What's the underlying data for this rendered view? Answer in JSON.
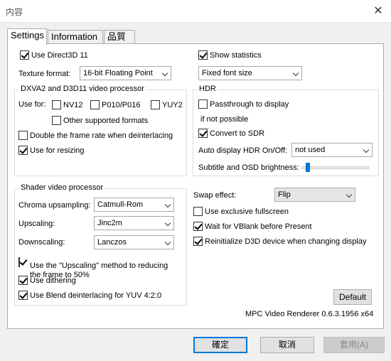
{
  "window": {
    "title": "内容",
    "close_glyph": "✕"
  },
  "tabs": [
    "Settings",
    "Information",
    "品質"
  ],
  "left": {
    "use_d3d11": {
      "label": "Use Direct3D 11",
      "checked": true
    },
    "texture_format": {
      "label": "Texture format:",
      "value": "16-bit Floating Point"
    },
    "dxva": {
      "title": "DXVA2 and D3D11 video processor",
      "use_for_label": "Use for:",
      "nv12": {
        "label": "NV12",
        "checked": false
      },
      "p010": {
        "label": "P010/P016",
        "checked": false
      },
      "yuy2": {
        "label": "YUY2",
        "checked": false
      },
      "other": {
        "label": "Other supported formats",
        "checked": false
      },
      "double_rate": {
        "label": "Double the frame rate when deinterlacing",
        "checked": false
      },
      "resizing": {
        "label": "Use for resizing",
        "checked": true
      }
    },
    "shader": {
      "title": "Shader video processor",
      "chroma_label": "Chroma upsampling:",
      "chroma_value": "Catmull-Rom",
      "upscaling_label": "Upscaling:",
      "upscaling_value": "Jinc2m",
      "downscaling_label": "Downscaling:",
      "downscaling_value": "Lanczos",
      "use_upscaling_method": {
        "label_line1": "Use the \"Upscaling\" method to reducing",
        "label_line2": "the frame to 50%",
        "checked": true
      },
      "dithering": {
        "label": "Use dithering",
        "checked": true
      },
      "blend_deinterlace": {
        "label": "Use Blend deinterlacing for YUV 4:2:0",
        "checked": true
      }
    }
  },
  "right": {
    "show_stats": {
      "label": "Show statistics",
      "checked": true
    },
    "font_size": {
      "value": "Fixed font size"
    },
    "hdr": {
      "title": "HDR",
      "passthrough": {
        "label": "Passthrough to display",
        "checked": false
      },
      "if_not_possible": "if not possible",
      "convert_sdr": {
        "label": "Convert to SDR",
        "checked": true
      },
      "auto_label": "Auto display HDR On/Off:",
      "auto_value": "not used",
      "brightness_label": "Subtitle and OSD brightness:",
      "brightness_level": 0.06
    },
    "swap_label": "Swap effect:",
    "swap_value": "Flip",
    "exclusive_fs": {
      "label": "Use exclusive fullscreen",
      "checked": false
    },
    "vblank": {
      "label": "Wait for VBlank before Present",
      "checked": true
    },
    "reinit_d3d": {
      "label": "Reinitialize D3D device when changing display",
      "checked": true
    },
    "default_button": "Default",
    "version": "MPC Video Renderer 0.6.3.1956 x64"
  },
  "footer": {
    "ok": "確定",
    "cancel": "取消",
    "apply": "套用(A)"
  }
}
